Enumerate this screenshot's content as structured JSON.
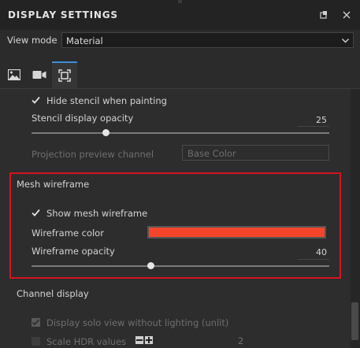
{
  "header": {
    "title": "DISPLAY SETTINGS"
  },
  "view_mode": {
    "label": "View mode",
    "value": "Material"
  },
  "tabs": [
    {
      "name": "image-tab"
    },
    {
      "name": "camera-tab"
    },
    {
      "name": "viewport-tab",
      "active": true
    }
  ],
  "stencil": {
    "hide_label": "Hide stencil when painting",
    "hide_checked": true,
    "opacity_label": "Stencil display opacity",
    "opacity_value": "25",
    "opacity_fraction": 0.25
  },
  "projection": {
    "label": "Projection preview channel",
    "value": "Base Color"
  },
  "mesh": {
    "section_label": "Mesh wireframe",
    "show_label": "Show mesh wireframe",
    "show_checked": true,
    "color_label": "Wireframe color",
    "color": "#f4452b",
    "opacity_label": "Wireframe opacity",
    "opacity_value": "40",
    "opacity_fraction": 0.4
  },
  "channel": {
    "section_label": "Channel display",
    "solo_label": "Display solo view without lighting (unlit)",
    "solo_checked": true,
    "hdr_label": "Scale HDR values",
    "hdr_value": "2"
  },
  "colors": {
    "accent": "#3d8fd6",
    "highlight": "#d4141e"
  }
}
